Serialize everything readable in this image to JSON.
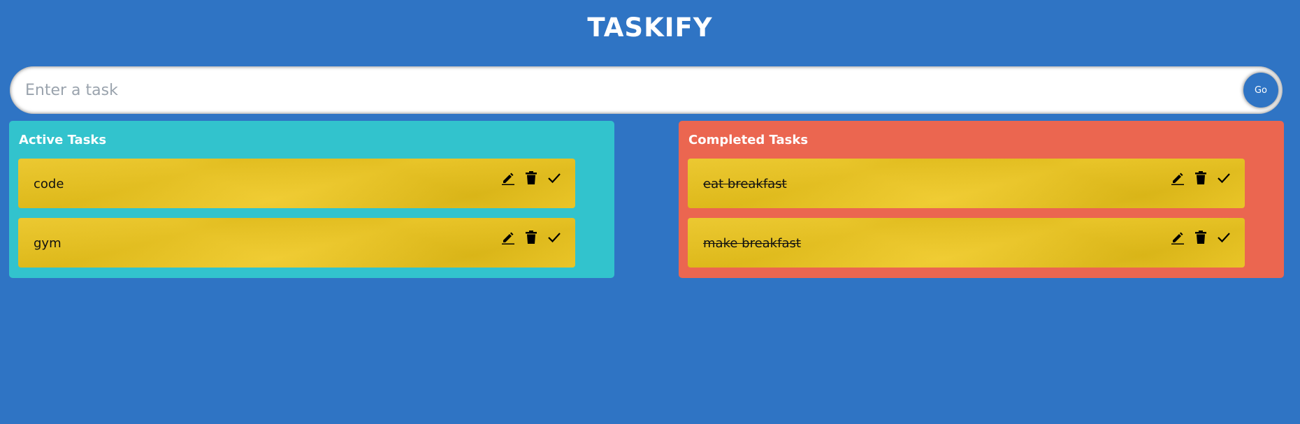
{
  "app": {
    "title": "TASKIFY"
  },
  "input": {
    "placeholder": "Enter a task",
    "value": "",
    "go_label": "Go"
  },
  "active": {
    "title": "Active Tasks",
    "tasks": [
      {
        "text": "code"
      },
      {
        "text": "gym"
      }
    ]
  },
  "completed": {
    "title": "Completed Tasks",
    "tasks": [
      {
        "text": "eat breakfast"
      },
      {
        "text": "make breakfast"
      }
    ]
  },
  "colors": {
    "background": "#2f74c4",
    "active_panel": "#32c3cd",
    "completed_panel": "#eb6650",
    "card": "#eec61a"
  },
  "icons": {
    "edit": "pencil-icon",
    "delete": "trash-icon",
    "done": "check-icon"
  }
}
